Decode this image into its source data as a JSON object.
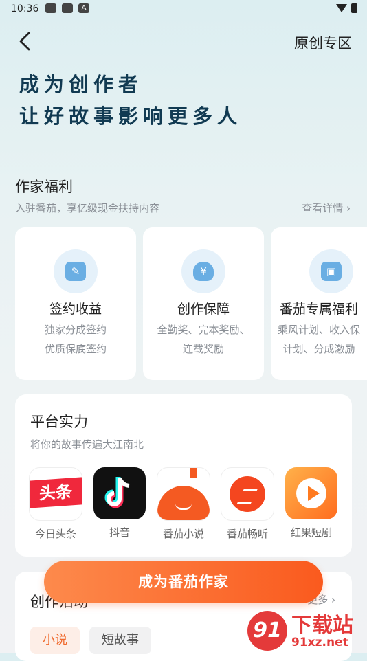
{
  "status_bar": {
    "time": "10:36"
  },
  "navbar": {
    "back_icon": "chevron-left",
    "right_label": "原创专区"
  },
  "hero": {
    "line1": "成为创作者",
    "line2": "让好故事影响更多人"
  },
  "benefits": {
    "title": "作家福利",
    "subtitle": "入驻番茄，享亿级现金扶持内容",
    "more_label": "查看详情",
    "cards": [
      {
        "icon": "contract-icon",
        "title": "签约收益",
        "desc1": "独家分成签约",
        "desc2": "优质保底签约"
      },
      {
        "icon": "money-bag-icon",
        "title": "创作保障",
        "desc1": "全勤奖、完本奖励、",
        "desc2": "连载奖励"
      },
      {
        "icon": "gift-icon",
        "title": "番茄专属福利",
        "desc1": "乘风计划、收入保",
        "desc2": "计划、分成激励"
      }
    ]
  },
  "platform": {
    "title": "平台实力",
    "subtitle": "将你的故事传遍大江南北",
    "apps": [
      {
        "name": "今日头条",
        "icon_text": "头条"
      },
      {
        "name": "抖音"
      },
      {
        "name": "番茄小说"
      },
      {
        "name": "番茄畅听"
      },
      {
        "name": "红果短剧"
      }
    ]
  },
  "activity": {
    "title": "创作活动",
    "more_label": "更多",
    "tabs": [
      {
        "label": "小说",
        "active": true
      },
      {
        "label": "短故事",
        "active": false
      }
    ]
  },
  "cta": {
    "label": "成为番茄作家"
  },
  "watermark": {
    "text1": "下载站",
    "text2": "91xz.net"
  },
  "colors": {
    "accent": "#fa5a1e",
    "hero_text": "#113a52"
  }
}
